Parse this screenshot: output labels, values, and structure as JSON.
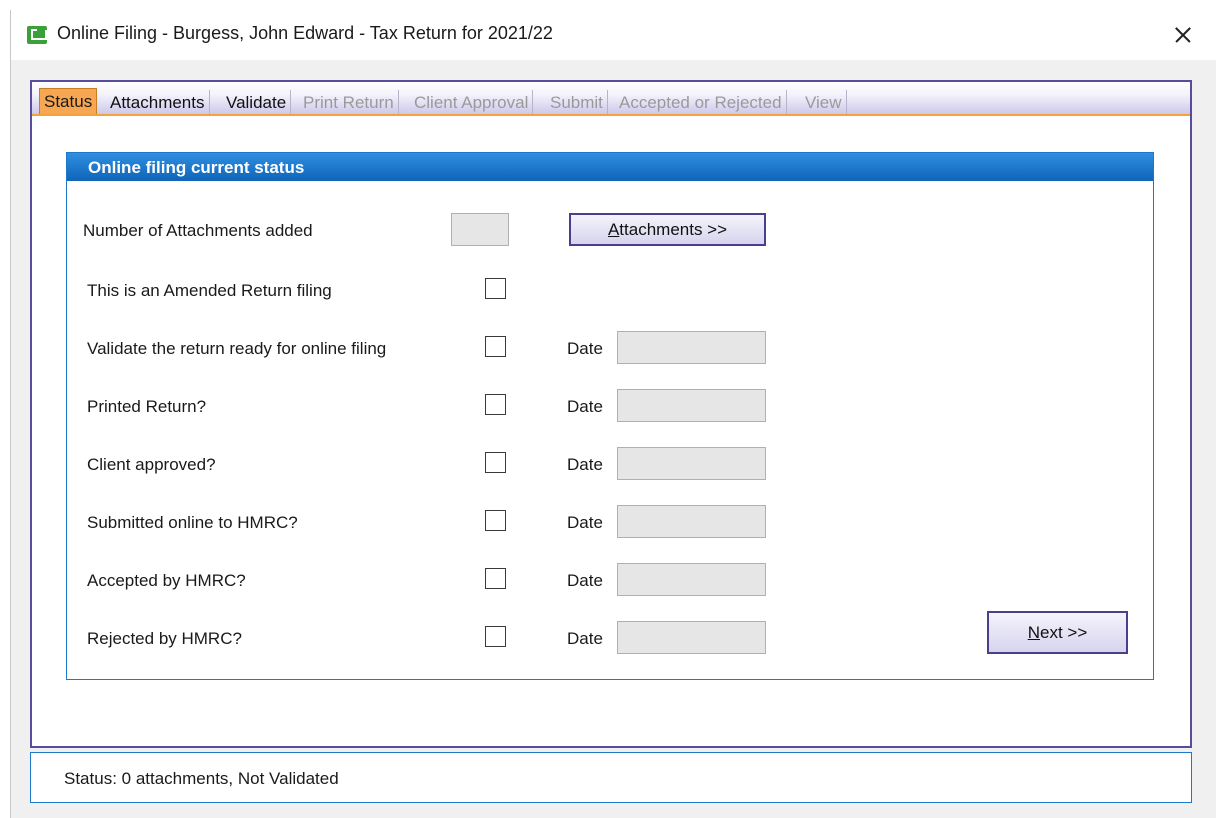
{
  "window": {
    "title": "Online Filing - Burgess, John Edward - Tax Return for 2021/22"
  },
  "tabs": [
    {
      "label": "Status",
      "state": "active"
    },
    {
      "label": "Attachments",
      "state": "enabled"
    },
    {
      "label": "Validate",
      "state": "enabled"
    },
    {
      "label": "Print Return",
      "state": "disabled"
    },
    {
      "label": "Client Approval",
      "state": "disabled"
    },
    {
      "label": "Submit",
      "state": "disabled"
    },
    {
      "label": "Accepted or Rejected",
      "state": "disabled"
    },
    {
      "label": "View",
      "state": "disabled"
    }
  ],
  "group": {
    "title": "Online filing current status",
    "attachments_label": "Number of Attachments added",
    "attachments_count": "",
    "attachments_button_hotkey": "A",
    "attachments_button_rest": "ttachments >>",
    "amended_label": "This is an Amended Return filing",
    "date_label": "Date",
    "rows": [
      {
        "label": "Validate the return ready for online filing",
        "checked": false,
        "date": ""
      },
      {
        "label": "Printed Return?",
        "checked": false,
        "date": ""
      },
      {
        "label": "Client approved?",
        "checked": false,
        "date": ""
      },
      {
        "label": "Submitted online to HMRC?",
        "checked": false,
        "date": ""
      },
      {
        "label": "Accepted by HMRC?",
        "checked": false,
        "date": ""
      },
      {
        "label": "Rejected by HMRC?",
        "checked": false,
        "date": ""
      }
    ],
    "next_button_hotkey": "N",
    "next_button_rest": "ext >>"
  },
  "status": {
    "text": "Status: 0 attachments, Not Validated"
  },
  "colors": {
    "accent_tab": "#f7a651",
    "header_blue": "#1f77c9",
    "button_border": "#4a3f8c",
    "app_icon": "#3aa13a"
  }
}
